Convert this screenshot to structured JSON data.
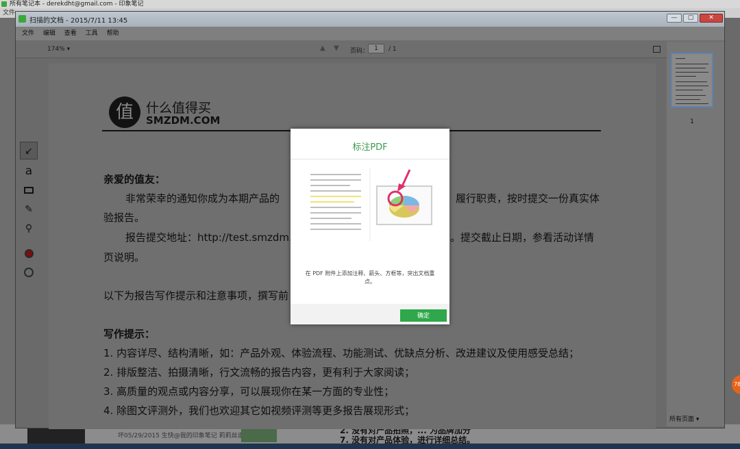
{
  "background_window": {
    "title": "所有笔记本 - derekdht@gmail.com - 印象笔记",
    "menu_first": "文件",
    "note_snippet": "坏05/29/2015 生快@我的印象笔记 莉莉丝遥风...",
    "doc_lines": [
      "2. 没有对产品拍照，... 为品牌加分",
      "7. 没有对产品体验，进行详细总结。"
    ]
  },
  "pdf_window": {
    "title": "扫描的文档 - 2015/7/11 13:45",
    "controls": {
      "minimize": "—",
      "maximize": "▢",
      "close": "✕"
    },
    "menu": [
      "文件",
      "编辑",
      "查看",
      "工具",
      "帮助"
    ],
    "toolbar": {
      "zoom": "174%",
      "zoom_caret": "▾",
      "page_label": "页码：",
      "page_value": "1",
      "page_total": "/ 1"
    },
    "tools": [
      "arrow-tool",
      "text-tool",
      "rectangle-tool",
      "pen-tool",
      "stamp-tool",
      "color-tool",
      "stroke-tool"
    ],
    "tool_glyphs": {
      "arrow": "↙",
      "text": "a",
      "pen": "✎",
      "stamp": "⚲"
    },
    "document": {
      "logo_glyph": "值",
      "logo_cn": "什么值得买",
      "logo_en": "SMZDM.COM",
      "greeting": "亲爱的值友：",
      "para1_a": "非常荣幸的通知你成为本期产品的",
      "para1_b": "履行职责，按时提交一份真实体",
      "para1_c": "验报告。",
      "para2_a": "报告提交地址：http://test.smzdm.",
      "para2_b": "。提交截止日期，参看活动详情",
      "para2_c": "页说明。",
      "para3": "以下为报告写作提示和注意事项，撰写前",
      "tips_heading": "写作提示：",
      "tips": [
        "1. 内容详尽、结构清晰，如：产品外观、体验流程、功能测试、优缺点分析、改进建议及使用感受总结；",
        "2. 排版整洁、拍摄清晰，行文流畅的报告内容，更有利于大家阅读；",
        "3. 高质量的观点或内容分享，可以展现你在某一方面的专业性；",
        "4. 除图文评测外，我们也欢迎其它如视频评测等更多报告展现形式；"
      ]
    },
    "thumbnails": {
      "page_number": "1",
      "filter": "所有页面 ▾"
    }
  },
  "modal": {
    "title": "标注PDF",
    "description": "在 PDF 附件上添加注释、箭头、方框等，突出文档重点。",
    "ok_label": "确定"
  },
  "badge_text": "78",
  "colors": {
    "accent_green": "#2ea84a",
    "title_green": "#3a9a4a",
    "annotation_pink": "#e0306b"
  }
}
